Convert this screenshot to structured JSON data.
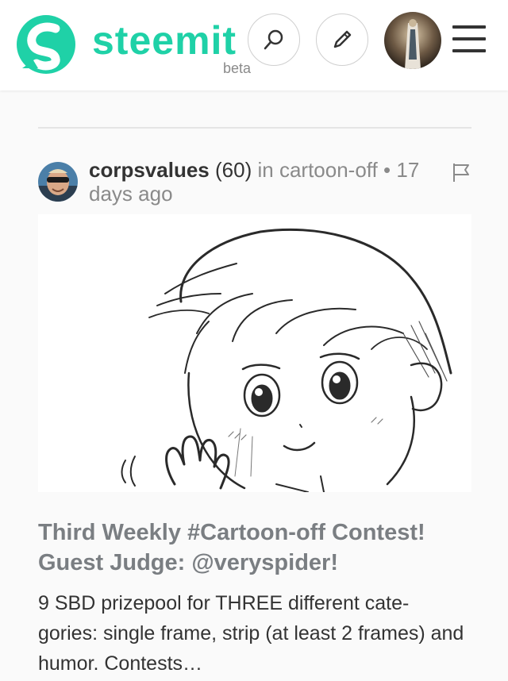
{
  "header": {
    "logo_text": "steemit",
    "logo_badge": "beta",
    "icons": {
      "logo": "steemit-logo-icon",
      "search": "search-icon",
      "compose": "pencil-icon",
      "avatar": "user-avatar",
      "menu": "hamburger-menu-icon"
    },
    "brand_color": "#1fd1a7"
  },
  "post": {
    "author": "corpsvalues",
    "reputation": "(60)",
    "category_prefix": "in",
    "category": "cartoon-off",
    "separator": "•",
    "time": "17 days ago",
    "title": "Third Weekly #Cartoon-off Contest! Guest Judge: @veryspider!",
    "excerpt": "9 SBD prizepool for THREE different cate-gories: single frame, strip (at least 2 frames) and humor. Contests…",
    "icons": {
      "flag": "flag-icon",
      "thumbnail": "cartoon-boy-waving-sketch"
    }
  }
}
